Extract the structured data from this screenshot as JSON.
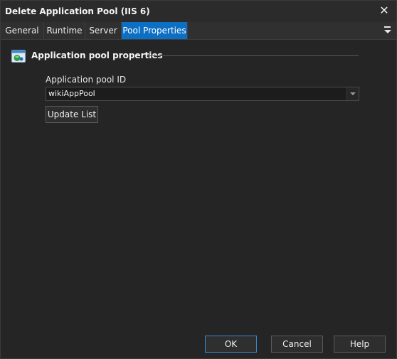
{
  "window": {
    "title": "Delete Application Pool (IIS 6)",
    "close_icon": "close-icon"
  },
  "tabs": [
    {
      "label": "General",
      "active": false
    },
    {
      "label": "Runtime",
      "active": false
    },
    {
      "label": "Server",
      "active": false
    },
    {
      "label": "Pool Properties",
      "active": true
    }
  ],
  "tab_menu_icon": "menu-dropdown-icon",
  "section": {
    "icon": "application-pool-icon",
    "title": "Application pool properties"
  },
  "pool_field": {
    "label": "Application pool ID",
    "value": "wikiAppPool"
  },
  "buttons": {
    "update_list": "Update List",
    "ok": "OK",
    "cancel": "Cancel",
    "help": "Help"
  },
  "colors": {
    "accent": "#0c6fc4",
    "background": "#252525"
  }
}
